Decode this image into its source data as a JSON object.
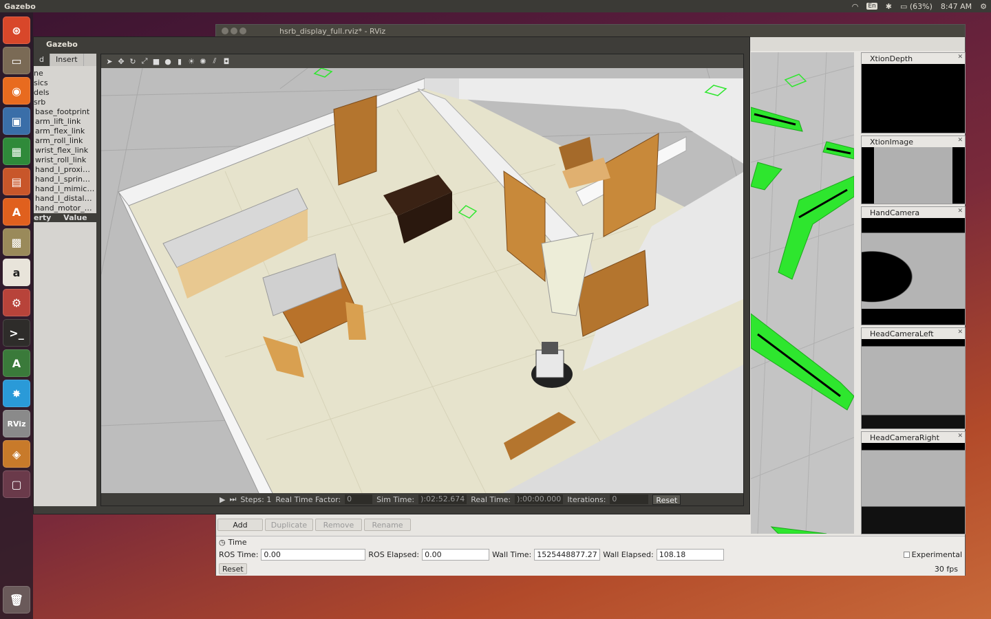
{
  "topbar": {
    "app_title": "Gazebo",
    "keyboard": "En",
    "battery": "(63%)",
    "clock": "8:47 AM"
  },
  "launcher": {
    "items": [
      {
        "name": "ubuntu-home-icon",
        "color": "#d8472a",
        "glyph": "⊛"
      },
      {
        "name": "files-icon",
        "color": "#7a6a55",
        "glyph": "▭"
      },
      {
        "name": "firefox-icon",
        "color": "#e86b1f",
        "glyph": "◉"
      },
      {
        "name": "image-viewer-icon",
        "color": "#3a6ea8",
        "glyph": "▣"
      },
      {
        "name": "spreadsheet-icon",
        "color": "#2f8a3a",
        "glyph": "▦"
      },
      {
        "name": "presentation-icon",
        "color": "#c8562a",
        "glyph": "▤"
      },
      {
        "name": "software-center-icon",
        "color": "#e0601e",
        "glyph": "A"
      },
      {
        "name": "archive-icon",
        "color": "#9a8a5a",
        "glyph": "▩"
      },
      {
        "name": "amazon-icon",
        "color": "#e8e4da",
        "glyph": "a"
      },
      {
        "name": "settings-icon",
        "color": "#b8433a",
        "glyph": "⚙"
      },
      {
        "name": "terminal-icon",
        "color": "#2e2c2a",
        "glyph": ">_"
      },
      {
        "name": "software-updater-icon",
        "color": "#3a7a3a",
        "glyph": "A"
      },
      {
        "name": "bluetooth-tool-icon",
        "color": "#2a9ad8",
        "glyph": "✸"
      },
      {
        "name": "rviz-icon",
        "color": "#8a8a8a",
        "glyph": "RViz"
      },
      {
        "name": "gazebo-icon",
        "color": "#c87a2a",
        "glyph": "◈"
      },
      {
        "name": "workspace-icon",
        "color": "#6a3a4a",
        "glyph": "▢"
      }
    ]
  },
  "rviz": {
    "window_title": "hsrb_display_full.rviz* - RViz",
    "panels": [
      {
        "title": "XtionDepth"
      },
      {
        "title": "XtionImage"
      },
      {
        "title": "HandCamera"
      },
      {
        "title": "HeadCameraLeft"
      },
      {
        "title": "HeadCameraRight"
      }
    ],
    "buttons": {
      "add": "Add",
      "duplicate": "Duplicate",
      "remove": "Remove",
      "rename": "Rename"
    },
    "time": {
      "title": "Time",
      "ros_time_label": "ROS Time:",
      "ros_time": "0.00",
      "ros_elapsed_label": "ROS Elapsed:",
      "ros_elapsed": "0.00",
      "wall_time_label": "Wall Time:",
      "wall_time": "1525448877.27",
      "wall_elapsed_label": "Wall Elapsed:",
      "wall_elapsed": "108.18",
      "experimental": "Experimental",
      "reset": "Reset",
      "fps": "30 fps"
    }
  },
  "gazebo": {
    "window_title": "Gazebo",
    "tabs": [
      "d",
      "Insert"
    ],
    "tree": [
      "ne",
      "sics",
      "dels",
      "srb",
      "base_footprint",
      "arm_lift_link",
      "arm_flex_link",
      "arm_roll_link",
      "wrist_flex_link",
      "wrist_roll_link",
      "hand_l_proxi…",
      "hand_l_sprin…",
      "hand_l_mimic…",
      "hand_l_distal…",
      "hand_motor_…"
    ],
    "property_header": {
      "property": "erty",
      "value": "Value"
    },
    "status": {
      "steps_label": "Steps: 1",
      "rtf_label": "Real Time Factor:",
      "rtf": "0",
      "sim_time_label": "Sim Time:",
      "sim_time": "):02:52.674",
      "real_time_label": "Real Time:",
      "real_time": "):00:00.000",
      "iterations_label": "Iterations:",
      "iterations": "0",
      "reset": "Reset"
    }
  }
}
